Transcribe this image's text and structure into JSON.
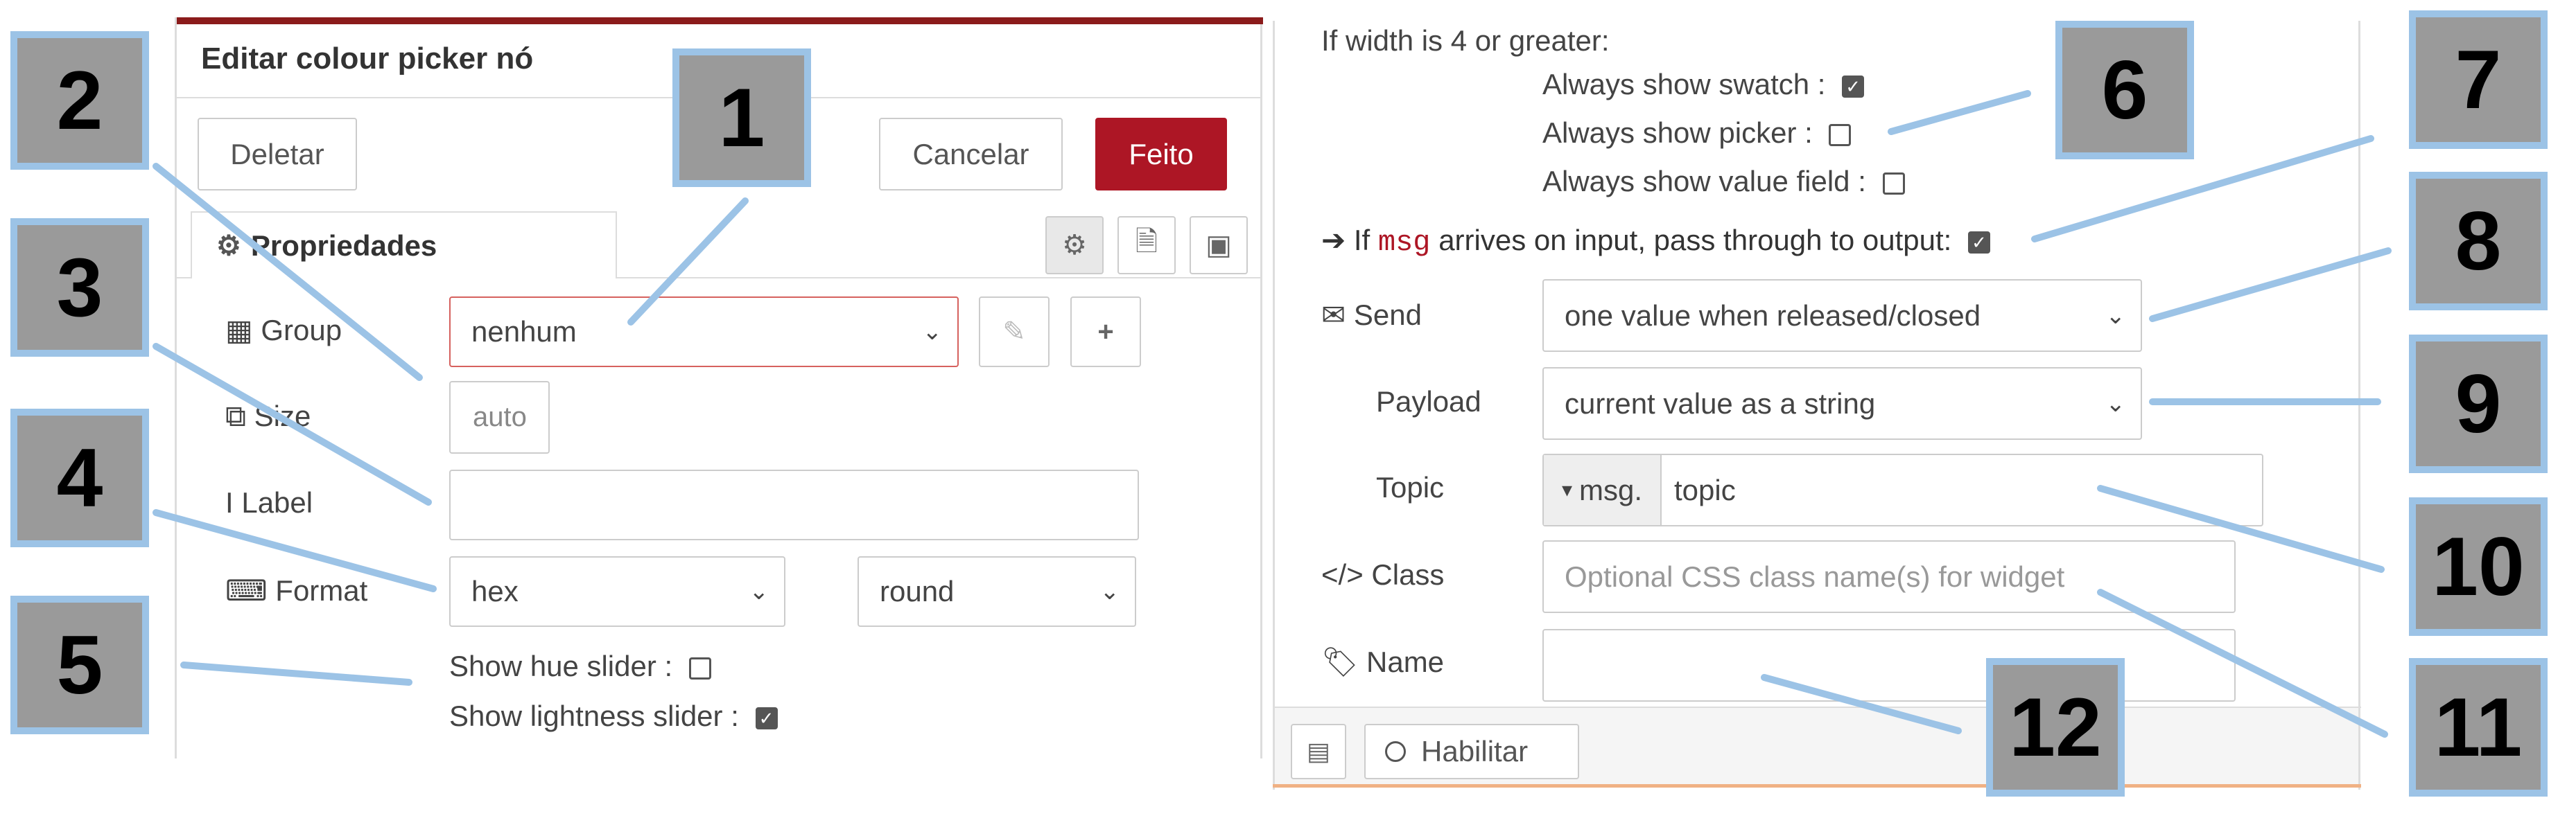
{
  "left_panel": {
    "title": "Editar colour picker nó",
    "delete_label": "Deletar",
    "cancel_label": "Cancelar",
    "done_label": "Feito",
    "tab_label": "Propriedades",
    "group_label": "Group",
    "group_value": "nenhum",
    "size_label": "Size",
    "size_value": "auto",
    "label_label": "Label",
    "label_value": "",
    "format_label": "Format",
    "format_value": "hex",
    "format_shape_value": "round",
    "show_hue_slider": "Show hue slider :",
    "show_lightness_slider": "Show lightness slider :"
  },
  "right_panel": {
    "width_note": "If width is 4 or greater:",
    "always_swatch": "Always show swatch :",
    "always_picker": "Always show picker :",
    "always_value_field": "Always show value field :",
    "passthrough_pre": "If",
    "passthrough_msg": "msg",
    "passthrough_post": "arrives on input, pass through to output:",
    "send_label": "Send",
    "send_value": "one value when released/closed",
    "payload_label": "Payload",
    "payload_value": "current value as a string",
    "topic_label": "Topic",
    "topic_prefix": "msg.",
    "topic_value": "topic",
    "class_label": "Class",
    "class_placeholder": "Optional CSS class name(s) for widget",
    "name_label": "Name",
    "name_value": "",
    "enable_label": "Habilitar"
  },
  "checkboxes": {
    "show_hue_slider": false,
    "show_lightness_slider": true,
    "always_swatch": true,
    "always_picker": false,
    "always_value_field": false,
    "passthrough": true
  },
  "callouts": [
    "1",
    "2",
    "3",
    "4",
    "5",
    "6",
    "7",
    "8",
    "9",
    "10",
    "11",
    "12"
  ],
  "colors": {
    "accent_red": "#ad1625",
    "callout_border": "#9cc3e6",
    "callout_fill": "#9a9a9a"
  }
}
